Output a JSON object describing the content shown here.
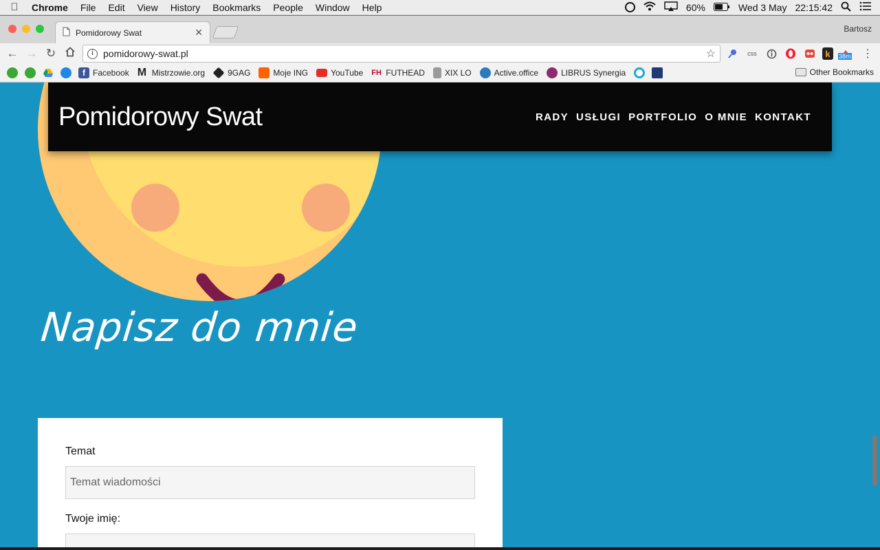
{
  "menubar": {
    "app_name": "Chrome",
    "items": [
      "File",
      "Edit",
      "View",
      "History",
      "Bookmarks",
      "People",
      "Window",
      "Help"
    ],
    "battery": "60%",
    "date": "Wed 3 May",
    "time": "22:15:42"
  },
  "browser": {
    "tab_title": "Pomidorowy Swat",
    "profile_name": "Bartosz",
    "url": "pomidorowy-swat.pl",
    "extensions": [
      "pin-ext",
      "css-ext",
      "info-ext",
      "opera-ext",
      "red-ext",
      "k-ext",
      "timer-ext"
    ],
    "extension_badge": "38m",
    "extension_css_label": "css"
  },
  "bookmarks": {
    "items": [
      {
        "label": "",
        "color": "#3aa835"
      },
      {
        "label": "",
        "color": "#3aa835"
      },
      {
        "label": "",
        "color": "#f4b400"
      },
      {
        "label": "",
        "color": "#1e88e5"
      },
      {
        "label": "Facebook",
        "color": "#3b5998"
      },
      {
        "label": "Mistrzowie.org",
        "color": "#111111"
      },
      {
        "label": "9GAG",
        "color": "#222222"
      },
      {
        "label": "Moje ING",
        "color": "#ff6200"
      },
      {
        "label": "YouTube",
        "color": "#e52d27"
      },
      {
        "label": "FUTHEAD",
        "color": "#c2002f"
      },
      {
        "label": "XIX LO",
        "color": "#777777"
      },
      {
        "label": "Active.office",
        "color": "#2b7bbf"
      },
      {
        "label": "LIBRUS Synergia",
        "color": "#8e2a6e"
      },
      {
        "label": "",
        "color": "#1ea7d6"
      },
      {
        "label": "",
        "color": "#1f3b73"
      }
    ],
    "other": "Other Bookmarks"
  },
  "site": {
    "brand": "Pomidorowy Swat",
    "nav": [
      "RADY",
      "USŁUGI",
      "PORTFOLIO",
      "O MNIE",
      "KONTAKT"
    ],
    "contact_title": "Napisz do mnie",
    "form": {
      "subject_label": "Temat",
      "subject_placeholder": "Temat wiadomości",
      "name_label": "Twoje imię:"
    }
  },
  "colors": {
    "page_bg": "#1794c2",
    "header_bg": "#080808",
    "sun_outer": "#ffc872",
    "sun_inner": "#ffdd6e",
    "cheek": "#f8ab7a",
    "mouth": "#7d1a4c"
  }
}
